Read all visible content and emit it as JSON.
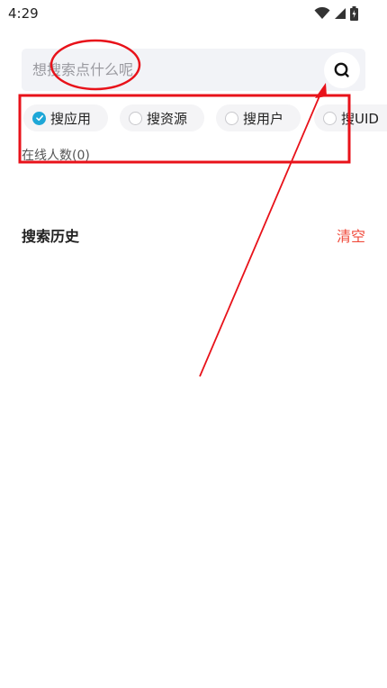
{
  "status_bar": {
    "time": "4:29",
    "icons": [
      "wifi-icon",
      "signal-icon",
      "battery-icon"
    ]
  },
  "search": {
    "placeholder": "想搜索点什么呢",
    "value": "",
    "button_icon": "search-icon"
  },
  "search_types": [
    {
      "label": "搜应用",
      "checked": true
    },
    {
      "label": "搜资源",
      "checked": false
    },
    {
      "label": "搜用户",
      "checked": false
    },
    {
      "label": "搜UID",
      "checked": false
    }
  ],
  "online_count": "在线人数(0)",
  "history": {
    "title": "搜索历史",
    "clear_label": "清空"
  },
  "colors": {
    "accent": "#1ea7d7",
    "clear": "#f04b3c",
    "annotation": "#e8121a"
  }
}
